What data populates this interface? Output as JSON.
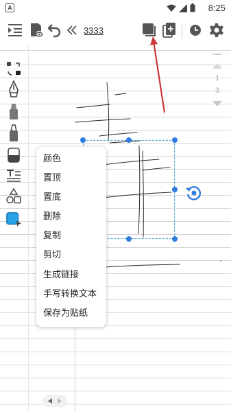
{
  "status_bar": {
    "left_badge": "A",
    "time": "8:25"
  },
  "toolbar": {
    "title": "3333",
    "icons": [
      "menu-list-icon",
      "notebook-view-icon",
      "undo-icon",
      "collapse-left-icon",
      "layers-icon",
      "add-page-icon",
      "history-clock-icon",
      "settings-gear-icon"
    ]
  },
  "page_nav": {
    "current": "1",
    "total": "3"
  },
  "sidebar_tools": [
    "lasso-select-icon",
    "fountain-pen-icon",
    "marker-icon",
    "highlighter-icon",
    "eraser-icon",
    "text-icon",
    "shapes-icon",
    "selection-fill-icon"
  ],
  "context_menu": {
    "items": [
      "颜色",
      "置顶",
      "置底",
      "删除",
      "复制",
      "剪切",
      "生成链接",
      "手写转换文本",
      "保存为贴纸"
    ]
  },
  "colors": {
    "accent": "#2f7de1",
    "selection_border": "#3a9fe0",
    "arrow": "#d0363b",
    "icon_gray": "#555555"
  }
}
